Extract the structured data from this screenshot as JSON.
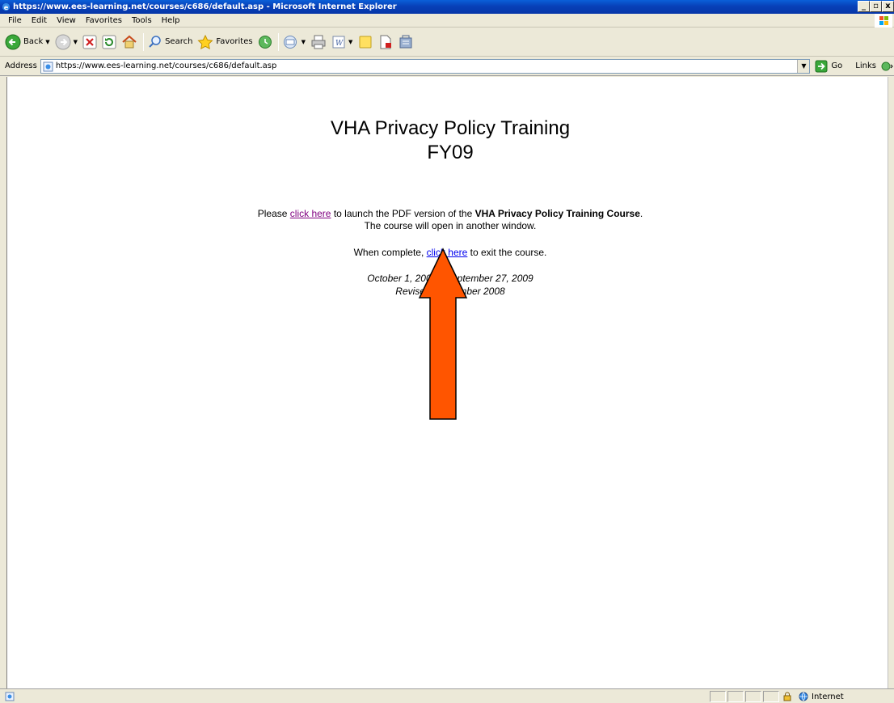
{
  "window": {
    "title": "https://www.ees-learning.net/courses/c686/default.asp - Microsoft Internet Explorer",
    "min_glyph": "_",
    "max_glyph": "▫",
    "close_glyph": "x"
  },
  "menu": {
    "items": [
      {
        "label": "File"
      },
      {
        "label": "Edit"
      },
      {
        "label": "View"
      },
      {
        "label": "Favorites"
      },
      {
        "label": "Tools"
      },
      {
        "label": "Help"
      }
    ]
  },
  "toolbar": {
    "back_label": "Back",
    "search_label": "Search",
    "favorites_label": "Favorites"
  },
  "address": {
    "label": "Address",
    "url": "https://www.ees-learning.net/courses/c686/default.asp",
    "go_label": "Go",
    "links_label": "Links"
  },
  "page": {
    "title_line1": "VHA Privacy Policy Training",
    "title_line2": "FY09",
    "launch_prefix": "Please ",
    "launch_link": "click here",
    "launch_middle": " to launch the PDF version of the ",
    "launch_bold": "VHA Privacy Policy Training Course",
    "launch_suffix": ".",
    "launch_line2": "The course will open in another window.",
    "exit_prefix": "When complete, ",
    "exit_link": "click here",
    "exit_suffix": " to exit the course.",
    "dates_line": "October 1, 2008 - September 27, 2009",
    "revised_line": "Revised September 2008"
  },
  "status": {
    "zone_label": "Internet"
  },
  "colors": {
    "arrow_fill": "#ff5500",
    "link": "#0000ee",
    "visited_link": "#800080",
    "titlebar": "#0840b8"
  }
}
